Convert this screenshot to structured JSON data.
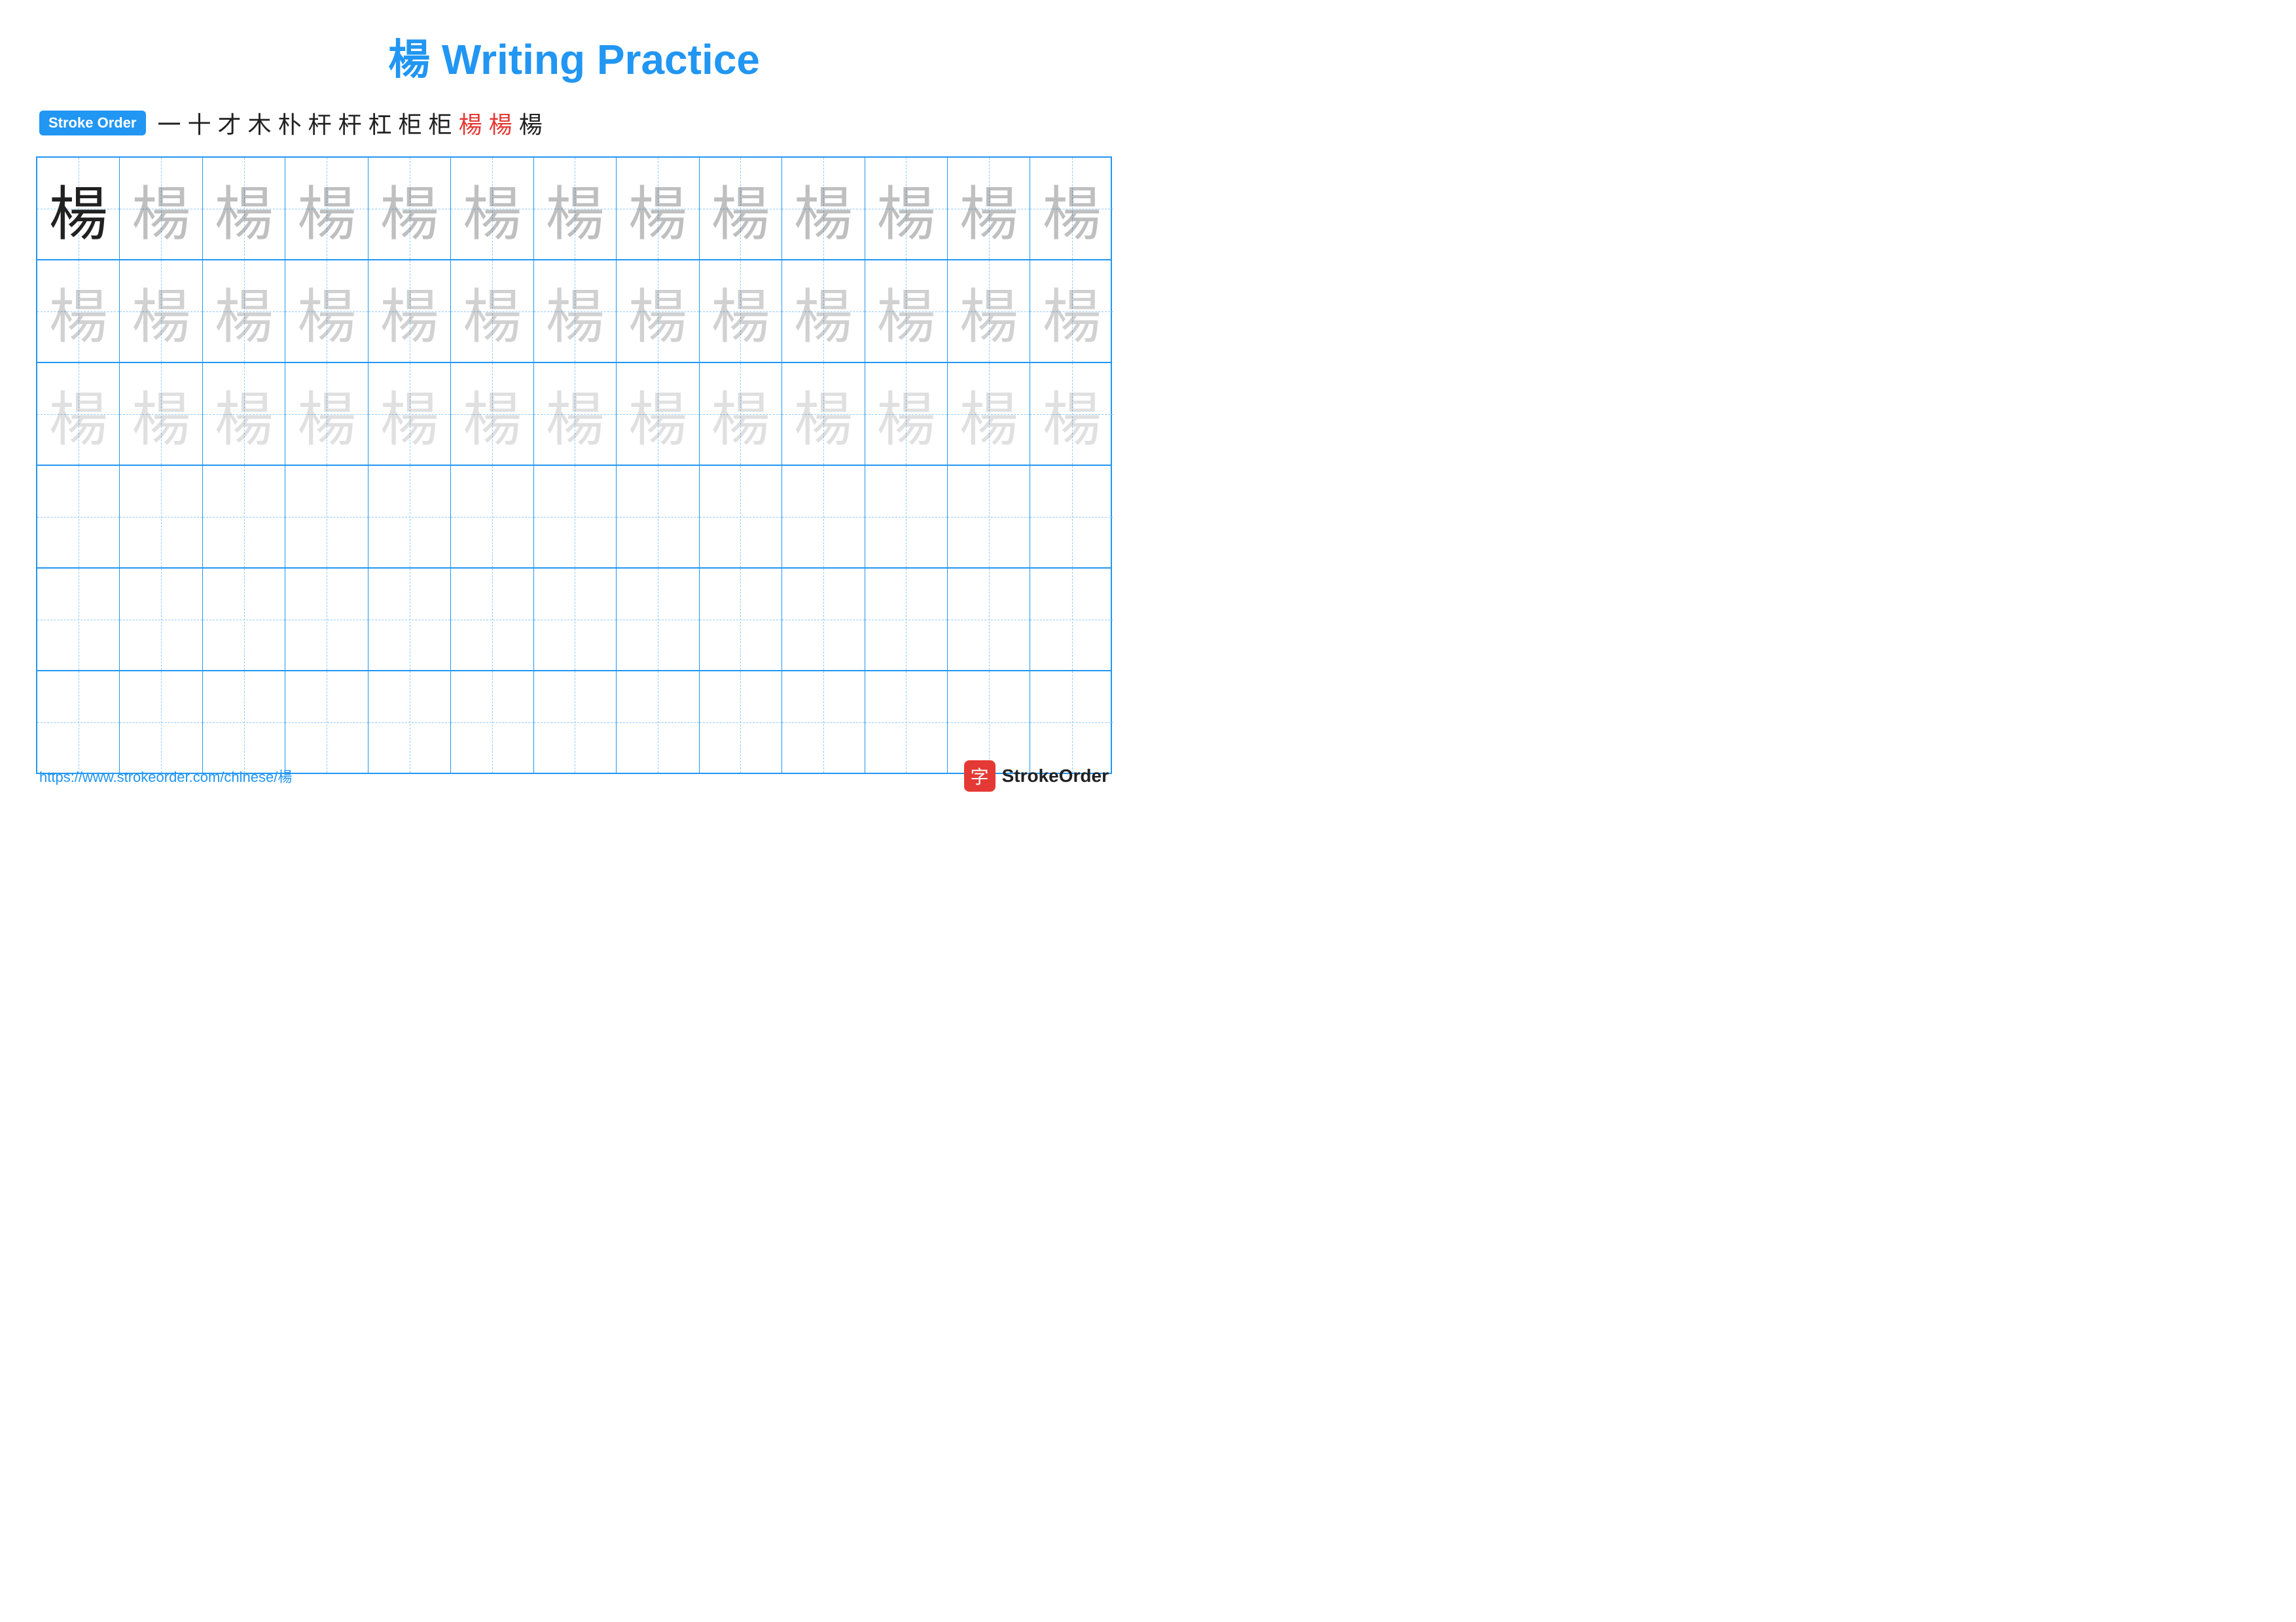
{
  "title": {
    "char": "楊",
    "text": " Writing Practice"
  },
  "stroke_order": {
    "badge": "Stroke Order",
    "strokes": [
      "一",
      "十",
      "才",
      "木",
      "朴",
      "杆",
      "杆",
      "杠",
      "柜",
      "柜",
      "楊",
      "楊",
      "楊"
    ]
  },
  "grid": {
    "rows": 6,
    "cols": 13,
    "char": "楊",
    "row_styles": [
      "solid",
      "light1",
      "light2",
      "empty",
      "empty",
      "empty"
    ]
  },
  "footer": {
    "url": "https://www.strokeorder.com/chinese/楊",
    "logo_char": "字",
    "logo_text": "StrokeOrder"
  }
}
